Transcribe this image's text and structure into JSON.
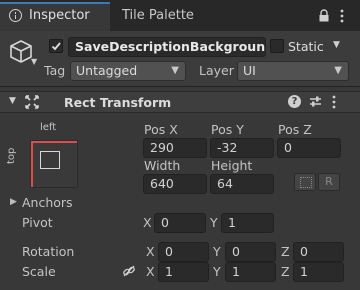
{
  "tabs": [
    {
      "label": "Inspector",
      "active": true,
      "icon": "inspector-info-icon"
    },
    {
      "label": "Tile Palette",
      "active": false
    }
  ],
  "tab_actions": [
    "lock-icon",
    "kebab-menu-icon"
  ],
  "gameobject": {
    "icon": "cube-icon",
    "active": true,
    "name": "SaveDescriptionBackground",
    "static_label": "Static",
    "static_checked": false,
    "tag_label": "Tag",
    "tag_value": "Untagged",
    "layer_label": "Layer",
    "layer_value": "UI"
  },
  "component": {
    "title": "Rect Transform",
    "icons": [
      "anchor-cross-icon",
      "help-icon",
      "preset-sliders-icon",
      "kebab-menu-icon"
    ],
    "anchor_preset": {
      "horizontal": "left",
      "vertical": "top"
    },
    "pos_labels": [
      "Pos X",
      "Pos Y",
      "Pos Z"
    ],
    "pos_values": [
      "290",
      "-32",
      "0"
    ],
    "size_labels": [
      "Width",
      "Height"
    ],
    "size_values": [
      "640",
      "64"
    ],
    "raw_edit_label": "R",
    "anchors_label": "Anchors",
    "pivot_label": "Pivot",
    "pivot": {
      "x_label": "X",
      "x": "0",
      "y_label": "Y",
      "y": "1"
    },
    "rotation_label": "Rotation",
    "rotation": {
      "x_label": "X",
      "x": "0",
      "y_label": "Y",
      "y": "0",
      "z_label": "Z",
      "z": "0"
    },
    "scale_label": "Scale",
    "scale": {
      "x_label": "X",
      "x": "1",
      "y_label": "Y",
      "y": "1",
      "z_label": "Z",
      "z": "1"
    }
  },
  "colors": {
    "background": "#383838",
    "field": "#2a2a2a",
    "accent": "#3a79bb",
    "anchor_red": "#e04b4b"
  }
}
